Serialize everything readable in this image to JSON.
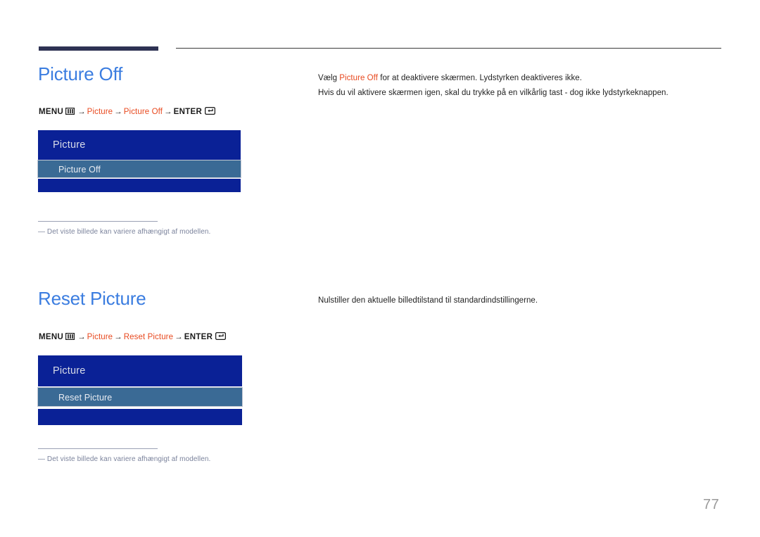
{
  "page": {
    "number": "77"
  },
  "sections": [
    {
      "heading": "Picture Off",
      "breadcrumb": {
        "menu_label": "MENU",
        "menu_icon": "menu-grid-icon",
        "arrow": "→",
        "step1": "Picture",
        "step2": "Picture Off",
        "enter_label": "ENTER",
        "enter_icon": "enter-key-icon"
      },
      "osd": {
        "header": "Picture",
        "selected_row": "Picture Off"
      },
      "footnote": {
        "dash": "―",
        "text": "Det viste billede kan variere afhængigt af modellen."
      },
      "description": {
        "line1_before": "Vælg ",
        "line1_accent": "Picture Off",
        "line1_after": " for at deaktivere skærmen. Lydstyrken deaktiveres ikke.",
        "line2": "Hvis du vil aktivere skærmen igen, skal du trykke på en vilkårlig tast - dog ikke lydstyrkeknappen."
      }
    },
    {
      "heading": "Reset Picture",
      "breadcrumb": {
        "menu_label": "MENU",
        "menu_icon": "menu-grid-icon",
        "arrow": "→",
        "step1": "Picture",
        "step2": "Reset Picture",
        "enter_label": "ENTER",
        "enter_icon": "enter-key-icon"
      },
      "osd": {
        "header": "Picture",
        "selected_row": "Reset Picture"
      },
      "footnote": {
        "dash": "―",
        "text": "Det viste billede kan variere afhængigt af modellen."
      },
      "description": {
        "line1": "Nulstiller den aktuelle billedtilstand til standardindstillingerne."
      }
    }
  ],
  "colors": {
    "heading_blue": "#3b7de0",
    "accent_orange": "#e8491f",
    "osd_deep_blue": "#0a2196",
    "osd_selected_blue": "#3a6a95",
    "top_bar_navy": "#2e3253",
    "footnote_gray": "#7b839c",
    "page_number_gray": "#9a9a9a"
  }
}
